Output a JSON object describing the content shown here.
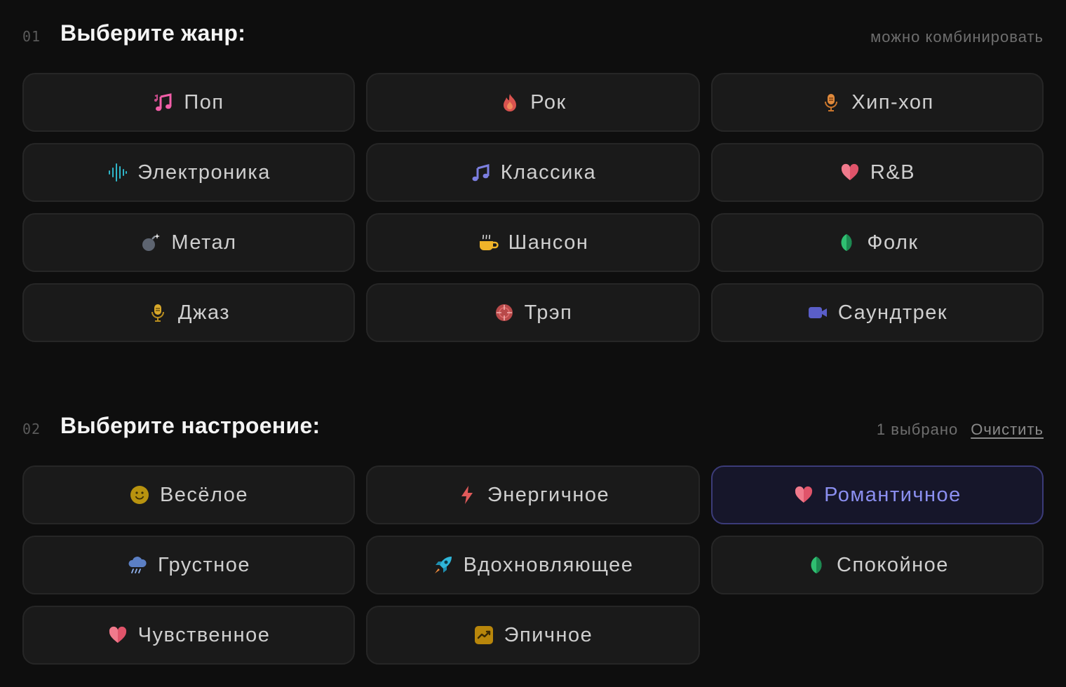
{
  "genre": {
    "step": "01",
    "title": "Выберите жанр:",
    "hint": "можно комбинировать",
    "items": [
      {
        "label": "Поп",
        "icon": "music-notes-icon"
      },
      {
        "label": "Рок",
        "icon": "fire-icon"
      },
      {
        "label": "Хип-хоп",
        "icon": "microphone-icon"
      },
      {
        "label": "Электроника",
        "icon": "sound-wave-icon"
      },
      {
        "label": "Классика",
        "icon": "music-note-icon"
      },
      {
        "label": "R&B",
        "icon": "heart-icon"
      },
      {
        "label": "Метал",
        "icon": "bomb-icon"
      },
      {
        "label": "Шансон",
        "icon": "hot-beverage-icon"
      },
      {
        "label": "Фолк",
        "icon": "leaf-icon"
      },
      {
        "label": "Джаз",
        "icon": "microphone-icon"
      },
      {
        "label": "Трэп",
        "icon": "crosshair-icon"
      },
      {
        "label": "Саундтрек",
        "icon": "video-camera-icon"
      }
    ]
  },
  "mood": {
    "step": "02",
    "title": "Выберите настроение:",
    "selected_count": "1 выбрано",
    "clear_label": "Очистить",
    "items": [
      {
        "label": "Весёлое",
        "icon": "smile-icon",
        "selected": false
      },
      {
        "label": "Энергичное",
        "icon": "lightning-icon",
        "selected": false
      },
      {
        "label": "Романтичное",
        "icon": "heart-icon",
        "selected": true
      },
      {
        "label": "Грустное",
        "icon": "rain-cloud-icon",
        "selected": false
      },
      {
        "label": "Вдохновляющее",
        "icon": "rocket-icon",
        "selected": false
      },
      {
        "label": "Спокойное",
        "icon": "leaf-icon",
        "selected": false
      },
      {
        "label": "Чувственное",
        "icon": "heart-icon",
        "selected": false
      },
      {
        "label": "Эпичное",
        "icon": "trending-chart-icon",
        "selected": false
      }
    ]
  },
  "colors": {
    "background": "#0e0e0e",
    "chip": "#1a1a1a",
    "chip_border": "#262626",
    "selected_bg": "#16162a",
    "selected_border": "#3b3b78",
    "selected_text": "#8b8ff0"
  }
}
